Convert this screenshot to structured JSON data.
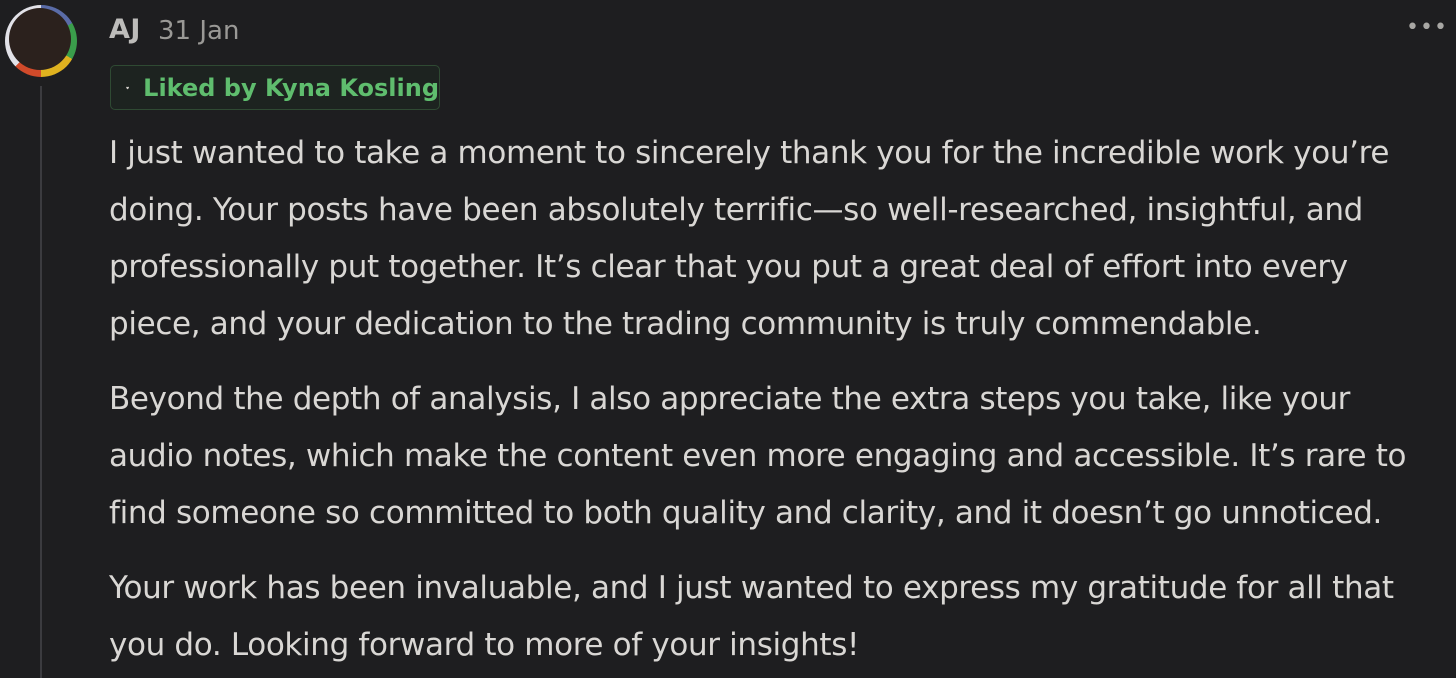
{
  "comment": {
    "author": "AJ",
    "date": "31 Jan",
    "more_label": "•••",
    "liked_by": "Liked by Kyna Kosling",
    "paragraphs": [
      [
        "I just wanted to take a moment to sincerely thank you for the incredible work you’re",
        "doing. Your posts have been absolutely terrific—so well-researched, insightful, and",
        "professionally put together. It’s clear that you put a great deal of effort into every",
        "piece, and your dedication to the trading community is truly commendable."
      ],
      [
        "Beyond the depth of analysis, I also appreciate the extra steps you take, like your",
        "audio notes, which make the content even more engaging and accessible. It’s rare to",
        "find someone so committed to both quality and clarity, and it doesn’t go unnoticed."
      ],
      [
        "Your work has been invaluable, and I just wanted to express my gratitude for all that",
        "you do. Looking forward to more of your insights!"
      ]
    ]
  },
  "icons": {
    "heart": "heart-icon",
    "more": "more-options-icon"
  },
  "colors": {
    "background": "#1e1e20",
    "liked_text": "#5fbd6e",
    "body_text": "#d9d7d4"
  }
}
